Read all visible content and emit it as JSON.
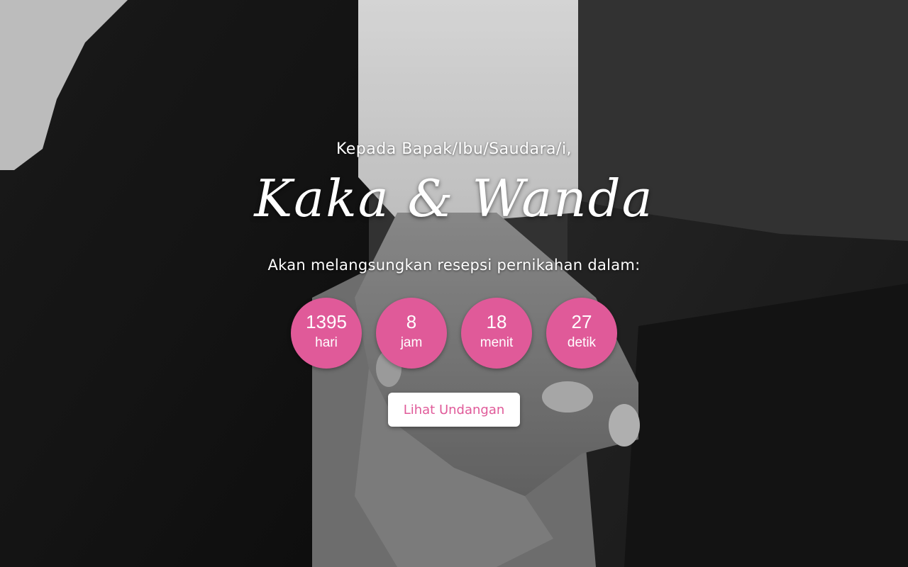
{
  "hero": {
    "greeting": "Kepada Bapak/Ibu/Saudara/i,",
    "names": "Kaka & Wanda",
    "subtitle": "Akan melangsungkan resepsi pernikahan dalam:"
  },
  "countdown": {
    "days": {
      "value": "1395",
      "unit": "hari"
    },
    "hours": {
      "value": "8",
      "unit": "jam"
    },
    "minutes": {
      "value": "18",
      "unit": "menit"
    },
    "seconds": {
      "value": "27",
      "unit": "detik"
    }
  },
  "cta": {
    "label": "Lihat Undangan"
  },
  "colors": {
    "accent": "#e05a99",
    "button_bg": "#ffffff",
    "text": "#ffffff"
  }
}
